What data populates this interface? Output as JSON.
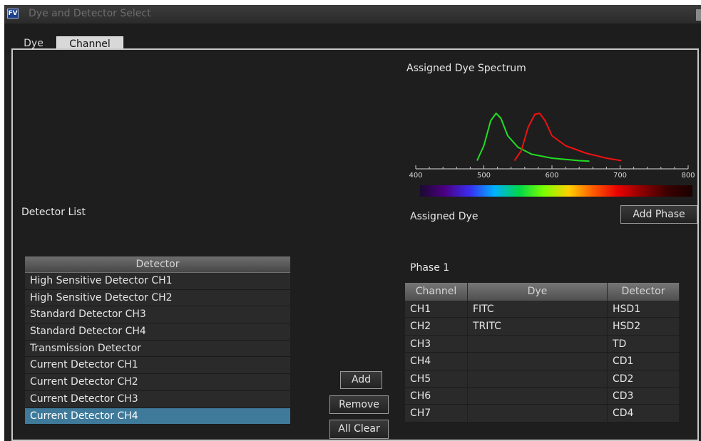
{
  "window": {
    "app_icon": "FV",
    "title": "Dye and Detector Select"
  },
  "tabs": [
    {
      "label": "Dye"
    },
    {
      "label": "Channel"
    }
  ],
  "spectrum_section": {
    "title": "Assigned Dye Spectrum",
    "axis_ticks": [
      "400",
      "500",
      "600",
      "700",
      "800"
    ],
    "axis_range": [
      400,
      800
    ],
    "curves": [
      {
        "color": "#22dd22",
        "points": [
          [
            490,
            0.05
          ],
          [
            500,
            0.35
          ],
          [
            510,
            0.85
          ],
          [
            518,
            1.0
          ],
          [
            525,
            0.9
          ],
          [
            535,
            0.55
          ],
          [
            550,
            0.32
          ],
          [
            570,
            0.18
          ],
          [
            600,
            0.1
          ],
          [
            640,
            0.05
          ],
          [
            655,
            0.04
          ]
        ]
      },
      {
        "color": "#ee1111",
        "points": [
          [
            545,
            0.05
          ],
          [
            555,
            0.25
          ],
          [
            565,
            0.72
          ],
          [
            575,
            0.98
          ],
          [
            582,
            1.0
          ],
          [
            590,
            0.85
          ],
          [
            600,
            0.55
          ],
          [
            620,
            0.35
          ],
          [
            650,
            0.2
          ],
          [
            680,
            0.1
          ],
          [
            702,
            0.05
          ]
        ]
      }
    ],
    "rainbow_colors": [
      "#1a0a30",
      "#4b0082",
      "#3a2cf0",
      "#00b0ff",
      "#00d84a",
      "#7aff00",
      "#ffd000",
      "#ff5a00",
      "#e80000",
      "#8a0000",
      "#3a0000",
      "#1a0000"
    ]
  },
  "detector_section": {
    "label": "Detector List",
    "header": "Detector",
    "items": [
      "High Sensitive Detector CH1",
      "High Sensitive Detector CH2",
      "Standard Detector CH3",
      "Standard Detector CH4",
      "Transmission Detector",
      "Current Detector CH1",
      "Current Detector CH2",
      "Current Detector CH3",
      "Current Detector CH4"
    ],
    "selected_index": 8
  },
  "assigned_section": {
    "label": "Assigned Dye",
    "add_phase_label": "Add Phase",
    "phase_label": "Phase 1",
    "columns": [
      "Channel",
      "Dye",
      "Detector"
    ],
    "rows": [
      [
        "CH1",
        "FITC",
        "HSD1"
      ],
      [
        "CH2",
        "TRITC",
        "HSD2"
      ],
      [
        "CH3",
        "",
        "TD"
      ],
      [
        "CH4",
        "",
        "CD1"
      ],
      [
        "CH5",
        "",
        "CD2"
      ],
      [
        "CH6",
        "",
        "CD3"
      ],
      [
        "CH7",
        "",
        "CD4"
      ]
    ]
  },
  "buttons": {
    "add": "Add",
    "remove": "Remove",
    "all_clear": "All Clear"
  }
}
